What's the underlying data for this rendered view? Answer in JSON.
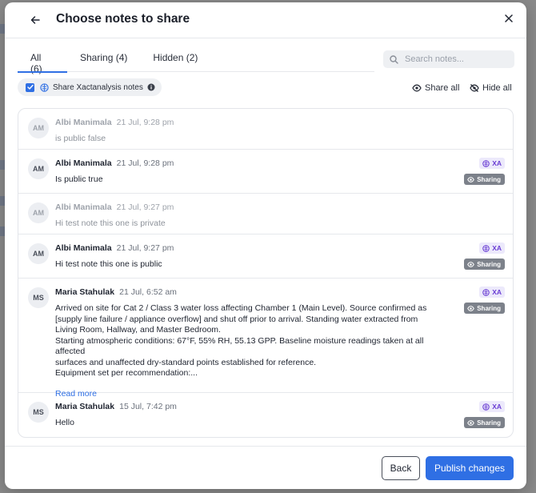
{
  "modal": {
    "title": "Choose notes to share",
    "tabs": [
      {
        "label": "All (6)",
        "active": true
      },
      {
        "label": "Sharing (4)",
        "active": false
      },
      {
        "label": "Hidden (2)",
        "active": false
      }
    ],
    "search": {
      "placeholder": "Search notes...",
      "value": ""
    },
    "xa_toggle": {
      "label": "Share Xactanalysis notes",
      "checked": true
    },
    "share_all_label": "Share all",
    "hide_all_label": "Hide all",
    "badge_xa": "XA",
    "badge_sharing": "Sharing",
    "notes": [
      {
        "initials": "AM",
        "author": "Albi Manimala",
        "time": "21 Jul, 9:28 pm",
        "lines": [
          "is public false"
        ],
        "shared": false,
        "read_more": ""
      },
      {
        "initials": "AM",
        "author": "Albi Manimala",
        "time": "21 Jul, 9:28 pm",
        "lines": [
          "Is public true"
        ],
        "shared": true,
        "read_more": ""
      },
      {
        "initials": "AM",
        "author": "Albi Manimala",
        "time": "21 Jul, 9:27 pm",
        "lines": [
          "Hi test note this one is private"
        ],
        "shared": false,
        "read_more": ""
      },
      {
        "initials": "AM",
        "author": "Albi Manimala",
        "time": "21 Jul, 9:27 pm",
        "lines": [
          "Hi test note this one is public"
        ],
        "shared": true,
        "read_more": ""
      },
      {
        "initials": "MS",
        "author": "Maria Stahulak",
        "time": "21 Jul, 6:52 am",
        "lines": [
          "Arrived on site for Cat 2 / Class 3 water loss affecting Chamber 1 (Main Level). Source confirmed as",
          "[supply line failure / appliance overflow] and shut off prior to arrival. Standing water extracted from",
          "Living Room, Hallway, and Master Bedroom.",
          "Starting atmospheric conditions: 67°F, 55% RH, 55.13 GPP. Baseline moisture readings taken at all affected",
          "surfaces and unaffected dry-standard points established for reference.",
          "Equipment set per recommendation:..."
        ],
        "shared": true,
        "read_more": "Read more"
      },
      {
        "initials": "MS",
        "author": "Maria Stahulak",
        "time": "15 Jul, 7:42 pm",
        "lines": [
          "Hello"
        ],
        "shared": true,
        "read_more": ""
      }
    ],
    "footer": {
      "back_label": "Back",
      "publish_label": "Publish changes"
    }
  },
  "colors": {
    "accent": "#2f6fe4",
    "xa_badge_bg": "#ece9fb",
    "xa_badge_text": "#6b3fd4",
    "sharing_badge_bg": "#7c818a"
  }
}
